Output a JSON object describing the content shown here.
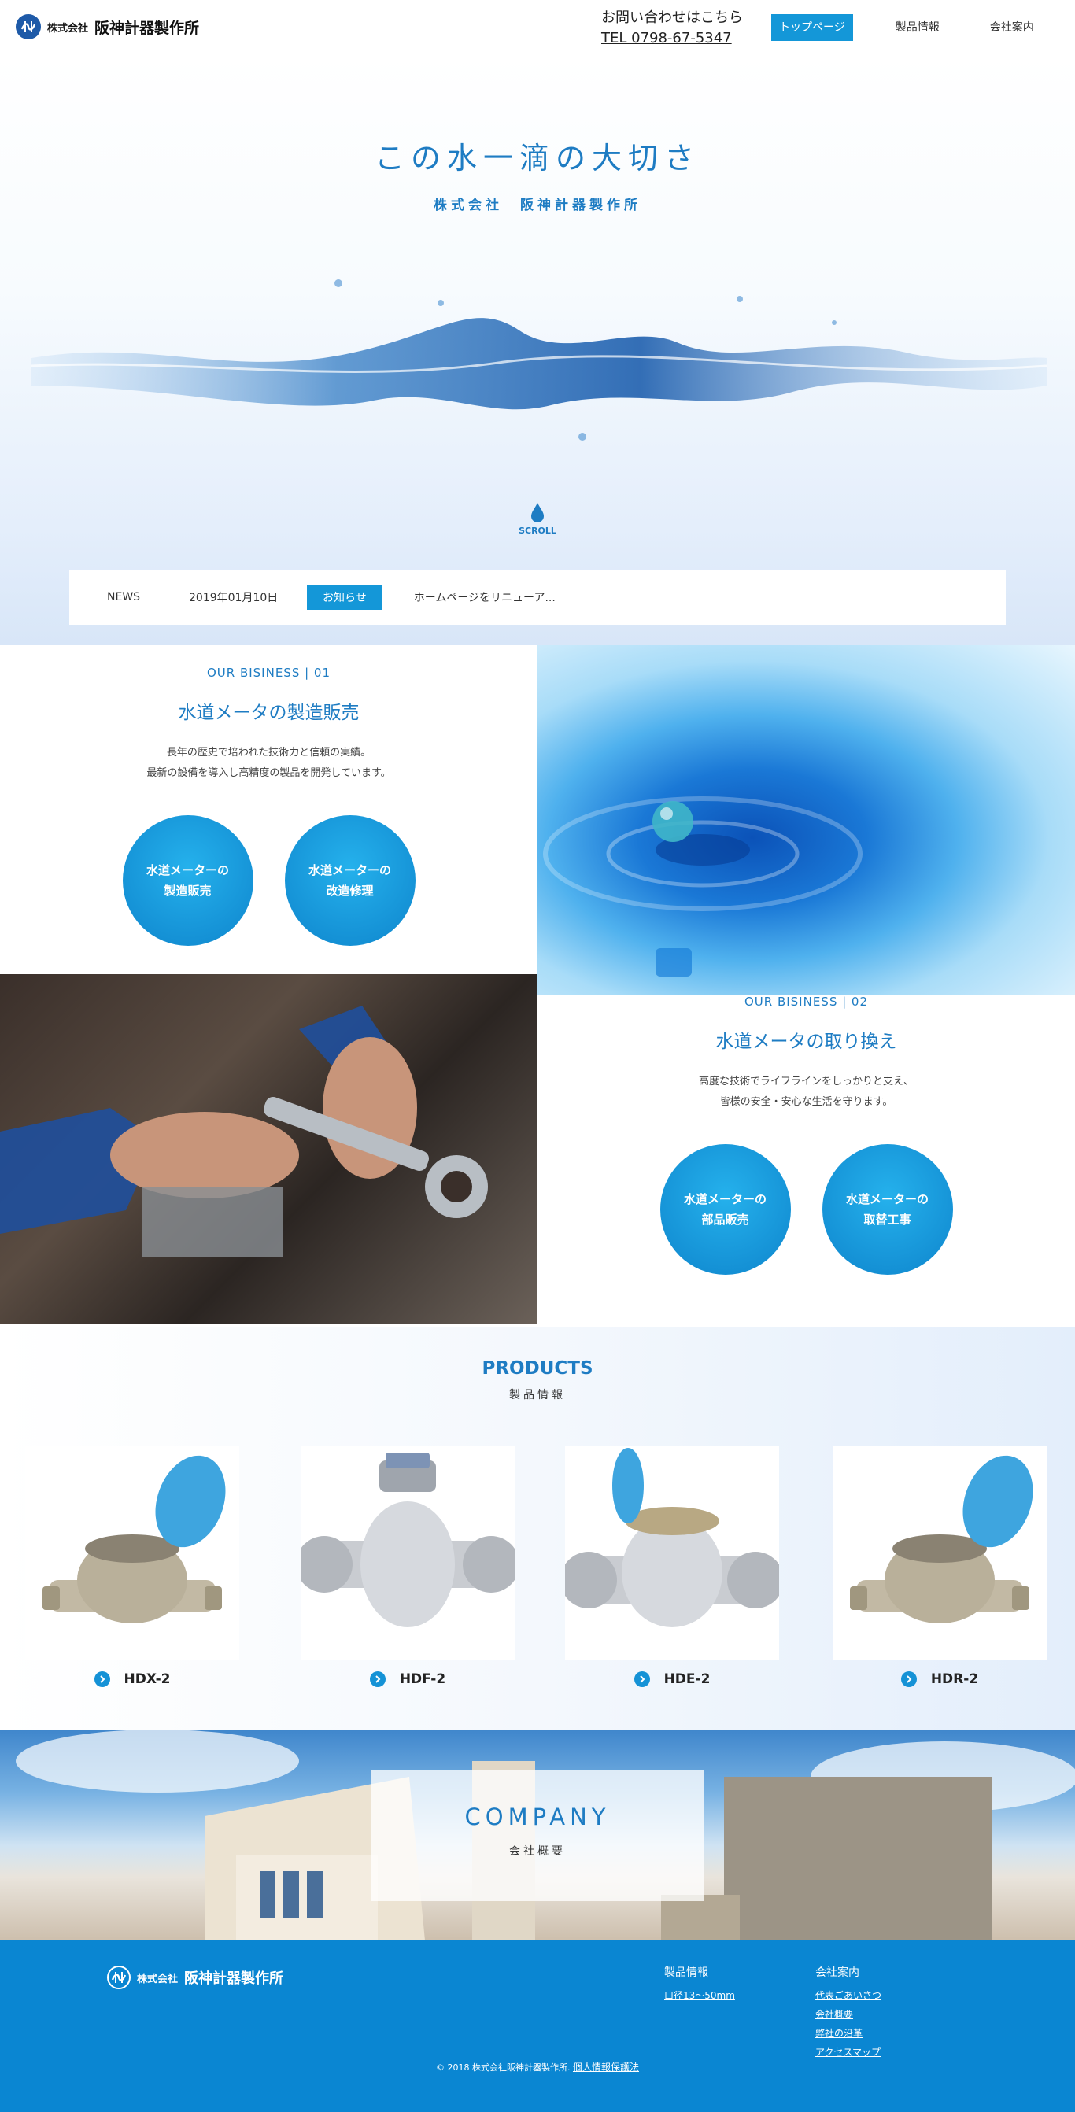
{
  "header": {
    "logo_small": "株式会社",
    "logo_big": "阪神計器製作所",
    "contact_label": "お問い合わせはこちら",
    "contact_tel": "TEL 0798-67-5347",
    "nav": [
      {
        "label": "トップページ"
      },
      {
        "label": "製品情報"
      },
      {
        "label": "会社案内"
      }
    ]
  },
  "hero": {
    "title": "この水一滴の大切さ",
    "subtitle": "株式会社　阪神計器製作所",
    "scroll_label": "SCROLL"
  },
  "news": {
    "label": "NEWS",
    "date": "2019年01月10日",
    "badge": "お知らせ",
    "text": "ホームページをリニューア..."
  },
  "business": [
    {
      "label": "OUR BISINESS | 01",
      "title": "水道メータの製造販売",
      "desc": [
        "長年の歴史で培われた技術力と信頼の実績。",
        "最新の設備を導入し高精度の製品を開発しています。"
      ],
      "buttons": [
        {
          "line1": "水道メーターの",
          "line2": "製造販売"
        },
        {
          "line1": "水道メーターの",
          "line2": "改造修理"
        }
      ]
    },
    {
      "label": "OUR BISINESS | 02",
      "title": "水道メータの取り換え",
      "desc": [
        "高度な技術でライフラインをしっかりと支え、",
        "皆様の安全・安心な生活を守ります。"
      ],
      "buttons": [
        {
          "line1": "水道メーターの",
          "line2": "部品販売"
        },
        {
          "line1": "水道メーターの",
          "line2": "取替工事"
        }
      ]
    }
  ],
  "products": {
    "title": "PRODUCTS",
    "subtitle": "製品情報",
    "items": [
      {
        "name": "HDX-2"
      },
      {
        "name": "HDF-2"
      },
      {
        "name": "HDE-2"
      },
      {
        "name": "HDR-2"
      }
    ]
  },
  "company": {
    "title": "COMPANY",
    "subtitle": "会社概要"
  },
  "footer": {
    "logo_small": "株式会社",
    "logo_big": "阪神計器製作所",
    "col1_heading": "製品情報",
    "col1_links": [
      "口径13〜50mm"
    ],
    "col2_heading": "会社案内",
    "col2_links": [
      "代表ごあいさつ",
      "会社概要",
      "弊社の沿革",
      "アクセスマップ"
    ],
    "copyright": "© 2018 株式会社阪神計器製作所.",
    "privacy": "個人情報保護法"
  },
  "colors": {
    "accent": "#1497d8",
    "heading_blue": "#1e7cc3",
    "footer": "#0a86d2"
  }
}
